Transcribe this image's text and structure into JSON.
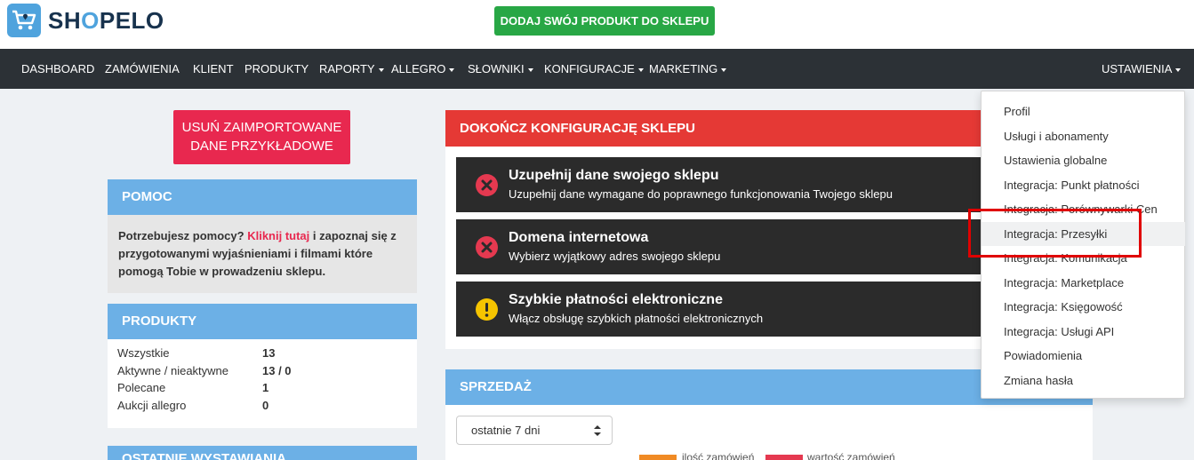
{
  "brand": {
    "name_prefix": "SH",
    "name_o": "O",
    "name_suffix": "PELO",
    "primary_color": "#4fa3dd",
    "dark_color": "#17324d"
  },
  "header": {
    "add_product_label": "DODAJ SWÓJ PRODUKT DO SKLEPU",
    "add_product_color": "#28a745"
  },
  "nav": {
    "items": [
      {
        "label": "DASHBOARD",
        "dropdown": false
      },
      {
        "label": "ZAMÓWIENIA",
        "dropdown": false
      },
      {
        "label": "KLIENT",
        "dropdown": false
      },
      {
        "label": "PRODUKTY",
        "dropdown": false
      },
      {
        "label": "RAPORTY",
        "dropdown": true
      },
      {
        "label": "ALLEGRO",
        "dropdown": true
      },
      {
        "label": "SŁOWNIKI",
        "dropdown": true
      },
      {
        "label": "KONFIGURACJE",
        "dropdown": true
      },
      {
        "label": "MARKETING",
        "dropdown": true
      }
    ],
    "settings_label": "USTAWIENIA"
  },
  "sidebar": {
    "delete_demo_line1": "USUŃ ZAIMPORTOWANE",
    "delete_demo_line2": "DANE PRZYKŁADOWE",
    "help": {
      "title": "POMOC",
      "text_before": "Potrzebujesz pomocy? ",
      "link": "Kliknij tutaj",
      "text_after": " i zapoznaj się z przygotowanymi wyjaśnieniami i filmami które pomogą Tobie w prowadzeniu sklepu."
    },
    "products": {
      "title": "PRODUKTY",
      "rows": [
        {
          "label": "Wszystkie",
          "value": "13"
        },
        {
          "label": "Aktywne / nieaktywne",
          "value": "13 / 0"
        },
        {
          "label": "Polecane",
          "value": "1"
        },
        {
          "label": "Aukcji allegro",
          "value": "0"
        }
      ]
    },
    "last_panel_title": "OSTATNIE WYSTAWIANIA"
  },
  "config": {
    "title": "DOKOŃCZ KONFIGURACJĘ SKLEPU",
    "tasks": [
      {
        "title": "Uzupełnij dane swojego sklepu",
        "desc": "Uzupełnij dane wymagane do poprawnego funkcjonowania Twojego sklepu",
        "icon": "error-icon",
        "color": "#e53950"
      },
      {
        "title": "Domena internetowa",
        "desc": "Wybierz wyjątkowy adres swojego sklepu",
        "icon": "error-icon",
        "color": "#e53950"
      },
      {
        "title": "Szybkie płatności elektroniczne",
        "desc": "Włącz obsługę szybkich płatności elektronicznych",
        "icon": "warning-icon",
        "color": "#f5c400"
      }
    ]
  },
  "sales": {
    "title": "SPRZEDAŻ",
    "period_selected": "ostatnie 7 dni",
    "legend": [
      {
        "label": "ilość zamówień",
        "color": "#f08a24"
      },
      {
        "label": "wartość zamówień",
        "color": "#e53950"
      }
    ]
  },
  "settings_menu": {
    "items": [
      "Profil",
      "Usługi i abonamenty",
      "Ustawienia globalne",
      "Integracja: Punkt płatności",
      "Integracja: Porównywarki Cen",
      "Integracja: Przesyłki",
      "Integracja: Komunikacja",
      "Integracja: Marketplace",
      "Integracja: Księgowość",
      "Integracja: Usługi API",
      "Powiadomienia",
      "Zmiana hasła"
    ],
    "active_index": 5
  }
}
